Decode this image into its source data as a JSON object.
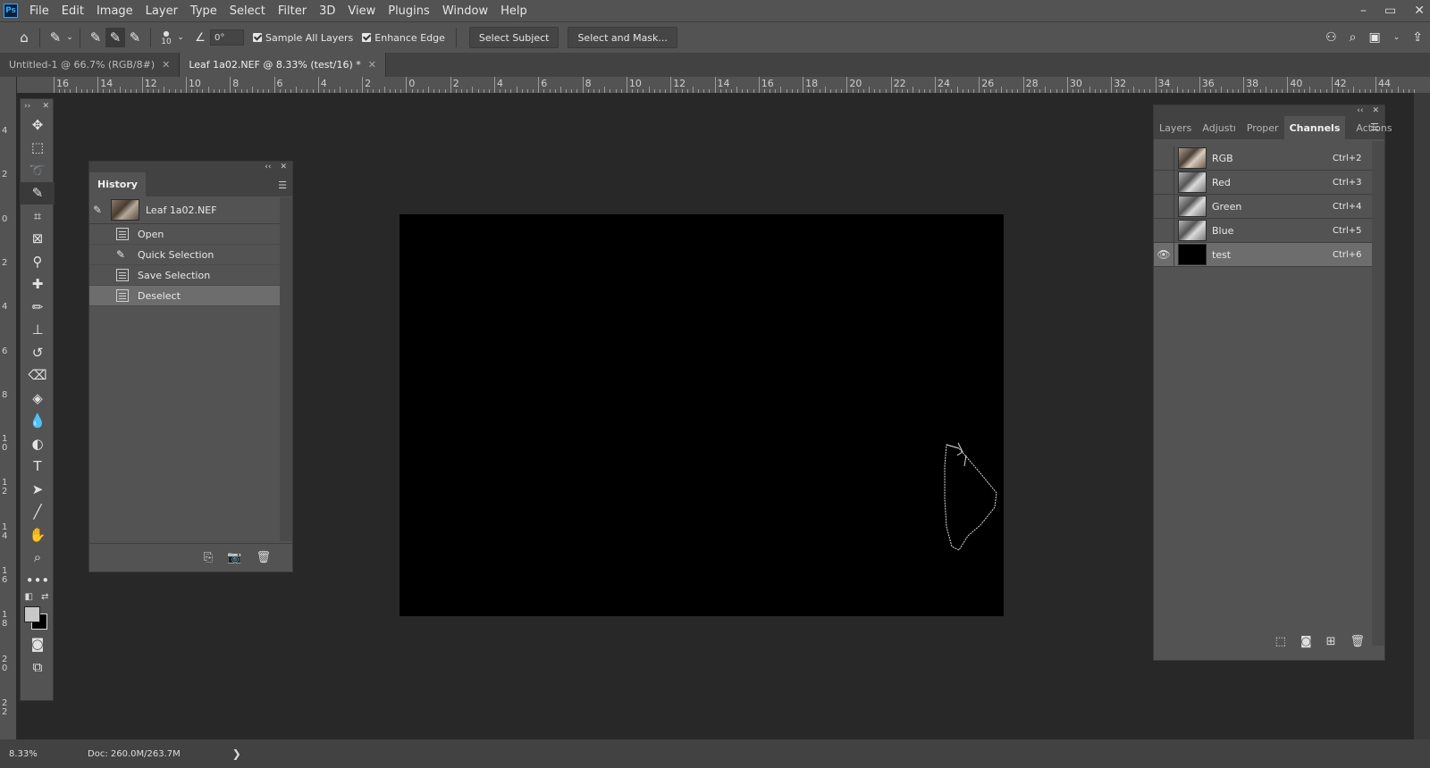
{
  "app": {
    "logo_text": "Ps"
  },
  "menu": [
    "File",
    "Edit",
    "Image",
    "Layer",
    "Type",
    "Select",
    "Filter",
    "3D",
    "View",
    "Plugins",
    "Window",
    "Help"
  ],
  "window_controls": {
    "minimize": "–",
    "restore": "▭",
    "close": "✕"
  },
  "options_bar": {
    "brush_size": "10",
    "angle_value": "0°",
    "sample_all_layers": "Sample All Layers",
    "enhance_edge": "Enhance Edge",
    "select_subject": "Select Subject",
    "select_and_mask": "Select and Mask..."
  },
  "doc_tabs": [
    {
      "label": "Untitled-1 @ 66.7% (RGB/8#)"
    },
    {
      "label": "Leaf 1a02.NEF @ 8.33% (test/16) *"
    }
  ],
  "hruler_labels": [
    "16",
    "14",
    "12",
    "10",
    "8",
    "6",
    "4",
    "2",
    "0",
    "2",
    "4",
    "6",
    "8",
    "10",
    "12",
    "14",
    "16",
    "18",
    "20",
    "22",
    "24",
    "26",
    "28",
    "30",
    "32",
    "34",
    "36",
    "38",
    "40",
    "42",
    "44"
  ],
  "vruler_labels": [
    "4",
    "2",
    "0",
    "2",
    "4",
    "6",
    "8",
    "1 0",
    "1 2",
    "1 4",
    "1 6",
    "1 8",
    "2 0",
    "2 2"
  ],
  "history": {
    "title": "History",
    "snapshot": "Leaf 1a02.NEF",
    "states": [
      "Open",
      "Quick Selection",
      "Save Selection",
      "Deselect"
    ]
  },
  "channels": {
    "tabs": [
      "Layers",
      "Adjustı",
      "Proper",
      "Channels",
      "Actions"
    ],
    "rows": [
      {
        "name": "RGB",
        "shortcut": "Ctrl+2"
      },
      {
        "name": "Red",
        "shortcut": "Ctrl+3"
      },
      {
        "name": "Green",
        "shortcut": "Ctrl+4"
      },
      {
        "name": "Blue",
        "shortcut": "Ctrl+5"
      },
      {
        "name": "test",
        "shortcut": "Ctrl+6"
      }
    ]
  },
  "status": {
    "zoom": "8.33%",
    "doc": "Doc: 260.0M/263.7M",
    "arrow": "❯"
  }
}
